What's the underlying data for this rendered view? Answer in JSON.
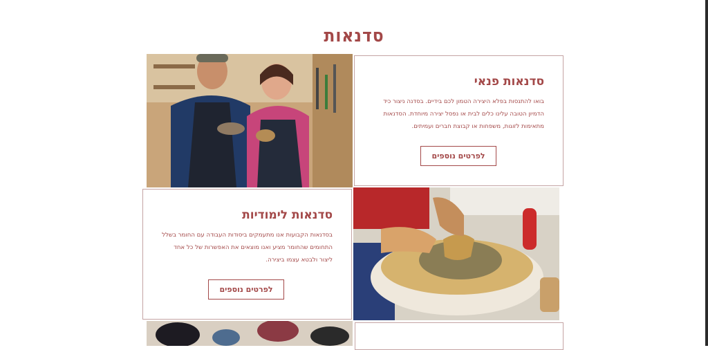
{
  "page": {
    "title": "סדנאות"
  },
  "cards": {
    "private": {
      "title": "סדנאות פנאי",
      "text": "בואו להתנסות בפלא היצירה הטמון לכם בידיים. בסדנה ניצור כיד הדמיון הטובה עלינו כלים לבית או נפסל יצירה מיוחדת. הסדנאות מתאימות לזוגות, משפחות או קבוצת חברים ועמיתים.",
      "button": "לפרטים נוספים"
    },
    "study": {
      "title": "סדנאות לימודיות",
      "text": "בסדנאות הקבועות אנו מתעמקים ביסודות העבודה עם החומר בשלל התחומים שהחומר מציע ואנו מוצאים את האפשרות של כל אחד ליצור ולבטא עצמו ביצירה.",
      "button": "לפרטים נוספים"
    }
  },
  "images": {
    "couple": "Couple smiling holding clay cups in pottery studio",
    "wheel": "Hands shaping clay on pottery wheel",
    "bottom": "Ceramic bowls on table"
  },
  "colors": {
    "accent": "#a34848",
    "border": "#c4a3a3"
  }
}
